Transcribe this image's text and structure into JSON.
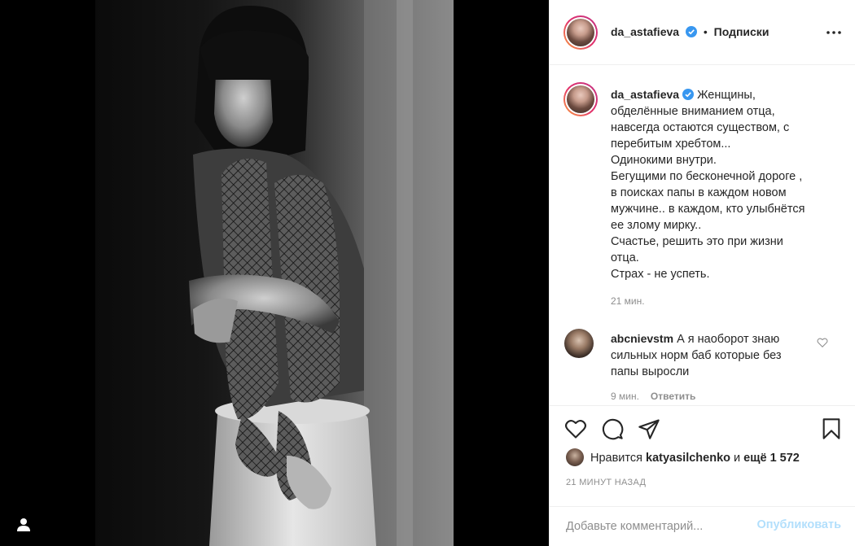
{
  "post": {
    "author": "da_astafieva",
    "follow_separator": "•",
    "follow_label": "Подписки",
    "caption_lines": [
      "Женщины,",
      "обделённые вниманием отца,",
      "навсегда остаются существом, с",
      "перебитым хребтом...",
      "Одинокими внутри.",
      "Бегущими по бесконечной дороге ,",
      "в поисках папы в каждом новом",
      "мужчине.. в каждом, кто улыбнётся",
      "ее злому мирку..",
      "Счастье, решить это при жизни",
      "отца.",
      "Страх - не успеть."
    ],
    "caption_time": "21 мин."
  },
  "comment": {
    "author": "abcnievstm",
    "text_line1": "А я наоборот знаю",
    "text_line2": "сильных норм баб которые без",
    "text_line3": "папы выросли",
    "time": "9 мин.",
    "reply_label": "Ответить"
  },
  "likes": {
    "prefix": "Нравится",
    "user": "katyasilchenko",
    "conjunction": "и",
    "others": "ещё 1 572"
  },
  "timestamp": "21 МИНУТ НАЗАД",
  "comment_box": {
    "placeholder": "Добавьте комментарий...",
    "publish_label": "Опубликовать"
  },
  "colors": {
    "verified": "#3897f0",
    "publish_disabled": "#b2dffc",
    "muted": "#8e8e8e"
  },
  "icons": [
    "profile-icon",
    "verified-icon",
    "more-icon",
    "heart-icon",
    "comment-icon",
    "share-icon",
    "bookmark-icon"
  ]
}
